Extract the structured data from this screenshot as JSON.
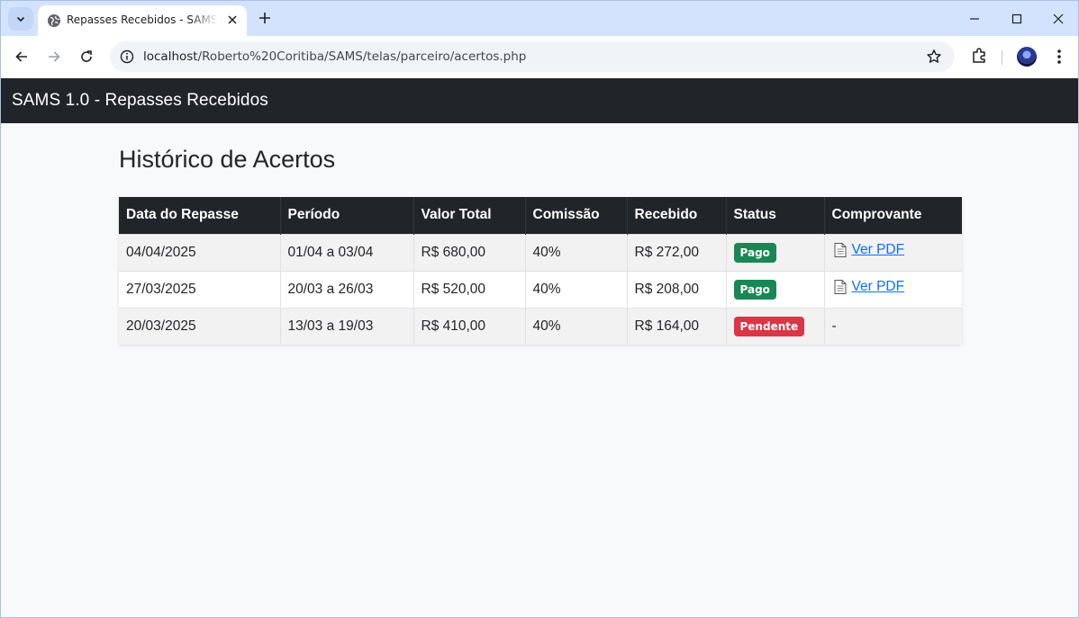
{
  "browser": {
    "tab_title": "Repasses Recebidos - SAMS Parceiro",
    "url_host": "localhost",
    "url_path": "/Roberto%20Coritiba/SAMS/telas/parceiro/acertos.php"
  },
  "navbar": {
    "brand": "SAMS 1.0 - Repasses Recebidos"
  },
  "page": {
    "heading": "Histórico de Acertos"
  },
  "table": {
    "headers": [
      "Data do Repasse",
      "Período",
      "Valor Total",
      "Comissão",
      "Recebido",
      "Status",
      "Comprovante"
    ],
    "rows": [
      {
        "data": "04/04/2025",
        "periodo": "01/04 a 03/04",
        "valor": "R$ 680,00",
        "comissao": "40%",
        "recebido": "R$ 272,00",
        "status": "Pago",
        "comprovante": "Ver PDF"
      },
      {
        "data": "27/03/2025",
        "periodo": "20/03 a 26/03",
        "valor": "R$ 520,00",
        "comissao": "40%",
        "recebido": "R$ 208,00",
        "status": "Pago",
        "comprovante": "Ver PDF"
      },
      {
        "data": "20/03/2025",
        "periodo": "13/03 a 19/03",
        "valor": "R$ 410,00",
        "comissao": "40%",
        "recebido": "R$ 164,00",
        "status": "Pendente",
        "comprovante": "-"
      }
    ]
  },
  "colors": {
    "navbar": "#212529",
    "pago": "#198754",
    "pendente": "#dc3545",
    "link": "#0d6efd"
  }
}
